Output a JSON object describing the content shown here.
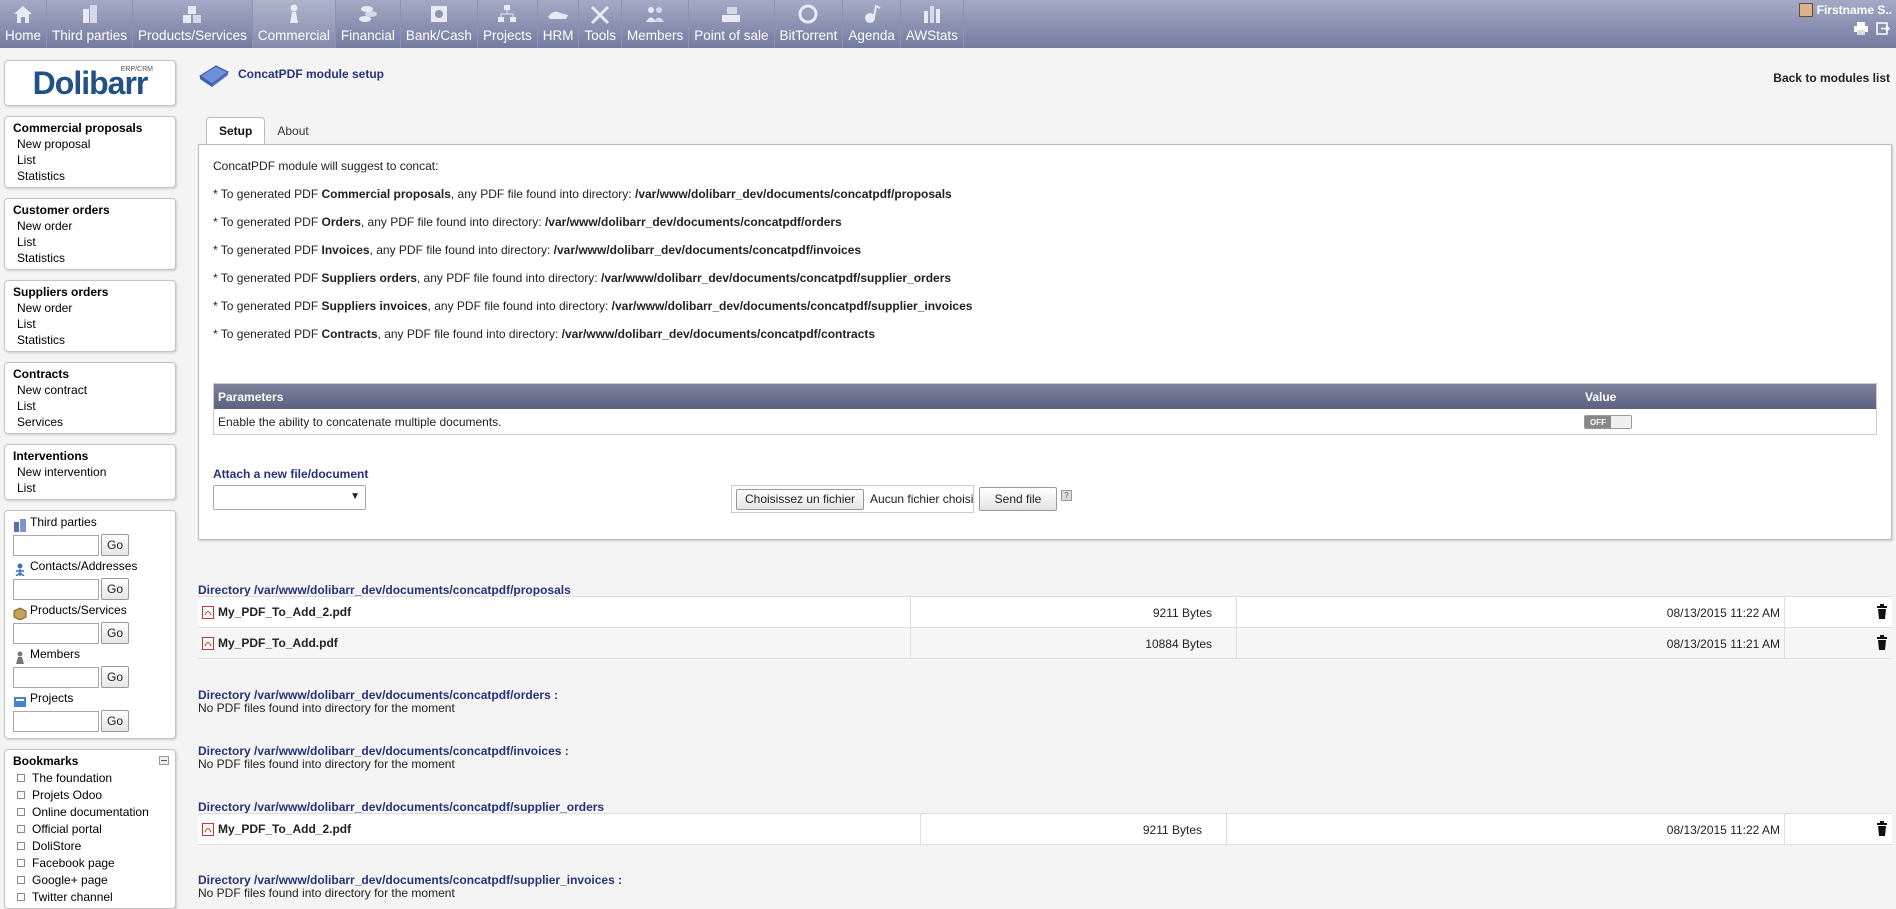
{
  "topmenu": [
    {
      "label": "Home",
      "icon": "home-icon"
    },
    {
      "label": "Third parties",
      "icon": "building-icon"
    },
    {
      "label": "Products/Services",
      "icon": "boxes-icon"
    },
    {
      "label": "Commercial",
      "icon": "person-icon"
    },
    {
      "label": "Financial",
      "icon": "coins-icon"
    },
    {
      "label": "Bank/Cash",
      "icon": "safe-icon"
    },
    {
      "label": "Projects",
      "icon": "project-icon"
    },
    {
      "label": "HRM",
      "icon": "hrm-icon"
    },
    {
      "label": "Tools",
      "icon": "tools-icon"
    },
    {
      "label": "Members",
      "icon": "members-icon"
    },
    {
      "label": "Point of sale",
      "icon": "pos-icon"
    },
    {
      "label": "BitTorrent",
      "icon": "bittorrent-icon"
    },
    {
      "label": "Agenda",
      "icon": "agenda-icon"
    },
    {
      "label": "AWStats",
      "icon": "stats-icon"
    }
  ],
  "user": {
    "name": "Firstname S.."
  },
  "logo": {
    "text": "Dolibarr",
    "sub": "ERP/CRM"
  },
  "left": {
    "blocks": [
      {
        "title": "Commercial proposals",
        "items": [
          "New proposal",
          "List",
          "Statistics"
        ]
      },
      {
        "title": "Customer orders",
        "items": [
          "New order",
          "List",
          "Statistics"
        ]
      },
      {
        "title": "Suppliers orders",
        "items": [
          "New order",
          "List",
          "Statistics"
        ]
      },
      {
        "title": "Contracts",
        "items": [
          "New contract",
          "List",
          "Services"
        ]
      },
      {
        "title": "Interventions",
        "items": [
          "New intervention",
          "List"
        ]
      }
    ],
    "search": [
      {
        "label": "Third parties",
        "go": "Go"
      },
      {
        "label": "Contacts/Addresses",
        "go": "Go"
      },
      {
        "label": "Products/Services",
        "go": "Go"
      },
      {
        "label": "Members",
        "go": "Go"
      },
      {
        "label": "Projects",
        "go": "Go"
      }
    ],
    "bookmarks": {
      "title": "Bookmarks",
      "items": [
        "The foundation",
        "Projets Odoo",
        "Online documentation",
        "Official portal",
        "DoliStore",
        "Facebook page",
        "Google+ page",
        "Twitter channel"
      ]
    }
  },
  "page": {
    "title": "ConcatPDF module setup",
    "back": "Back to modules list",
    "tabs": [
      {
        "label": "Setup"
      },
      {
        "label": "About"
      }
    ],
    "intro": "ConcatPDF module will suggest to concat:",
    "lines": [
      {
        "pre": "* To generated PDF ",
        "bold": "Commercial proposals",
        "mid": ", any PDF file found into directory: ",
        "path": "/var/www/dolibarr_dev/documents/concatpdf/proposals"
      },
      {
        "pre": "* To generated PDF ",
        "bold": "Orders",
        "mid": ", any PDF file found into directory: ",
        "path": "/var/www/dolibarr_dev/documents/concatpdf/orders"
      },
      {
        "pre": "* To generated PDF ",
        "bold": "Invoices",
        "mid": ", any PDF file found into directory: ",
        "path": "/var/www/dolibarr_dev/documents/concatpdf/invoices"
      },
      {
        "pre": "* To generated PDF ",
        "bold": "Suppliers orders",
        "mid": ", any PDF file found into directory: ",
        "path": "/var/www/dolibarr_dev/documents/concatpdf/supplier_orders"
      },
      {
        "pre": "* To generated PDF ",
        "bold": "Suppliers invoices",
        "mid": ", any PDF file found into directory: ",
        "path": "/var/www/dolibarr_dev/documents/concatpdf/supplier_invoices"
      },
      {
        "pre": "* To generated PDF ",
        "bold": "Contracts",
        "mid": ", any PDF file found into directory: ",
        "path": "/var/www/dolibarr_dev/documents/concatpdf/contracts"
      }
    ],
    "params": {
      "head": "Parameters",
      "value_head": "Value",
      "row": "Enable the ability to concatenate multiple documents.",
      "toggle": "OFF"
    },
    "attach": {
      "title": "Attach a new file/document",
      "choose": "Choisissez un fichier",
      "nofile": "Aucun fichier choisi",
      "send": "Send file",
      "help": "?"
    }
  },
  "directories": [
    {
      "title": "Directory /var/www/dolibarr_dev/documents/concatpdf/proposals",
      "files": [
        {
          "name": "My_PDF_To_Add_2.pdf",
          "size": "9211 Bytes",
          "date": "08/13/2015 11:22 AM"
        },
        {
          "name": "My_PDF_To_Add.pdf",
          "size": "10884 Bytes",
          "date": "08/13/2015 11:21 AM"
        }
      ]
    },
    {
      "title": "Directory /var/www/dolibarr_dev/documents/concatpdf/orders :",
      "empty": "No PDF files found into directory for the moment"
    },
    {
      "title": "Directory /var/www/dolibarr_dev/documents/concatpdf/invoices :",
      "empty": "No PDF files found into directory for the moment"
    },
    {
      "title": "Directory /var/www/dolibarr_dev/documents/concatpdf/supplier_orders",
      "files": [
        {
          "name": "My_PDF_To_Add_2.pdf",
          "size": "9211 Bytes",
          "date": "08/13/2015 11:22 AM"
        }
      ]
    },
    {
      "title": "Directory /var/www/dolibarr_dev/documents/concatpdf/supplier_invoices :",
      "empty": "No PDF files found into directory for the moment"
    }
  ]
}
